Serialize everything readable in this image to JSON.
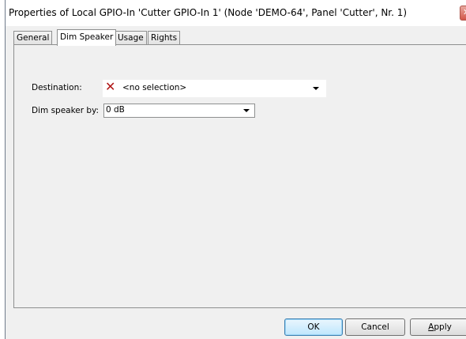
{
  "window": {
    "title": "Properties of Local GPIO-In 'Cutter GPIO-In 1' (Node 'DEMO-64', Panel 'Cutter', Nr. 1)"
  },
  "tabs": [
    {
      "label": "General",
      "active": false
    },
    {
      "label": "Dim Speaker",
      "active": true
    },
    {
      "label": "Usage",
      "active": false
    },
    {
      "label": "Rights",
      "active": false
    }
  ],
  "form": {
    "destination_label": "Destination:",
    "destination_value": "<no selection>",
    "dim_label": "Dim speaker by:",
    "dim_value": "0 dB"
  },
  "buttons": {
    "ok": "OK",
    "cancel": "Cancel",
    "apply_accel": "A",
    "apply_rest": "pply"
  },
  "colors": {
    "error_x": "#b01515",
    "default_button": "#bee6fd"
  },
  "icons": {
    "destination_status": "red-x-icon",
    "dropdown": "chevron-down-icon"
  }
}
